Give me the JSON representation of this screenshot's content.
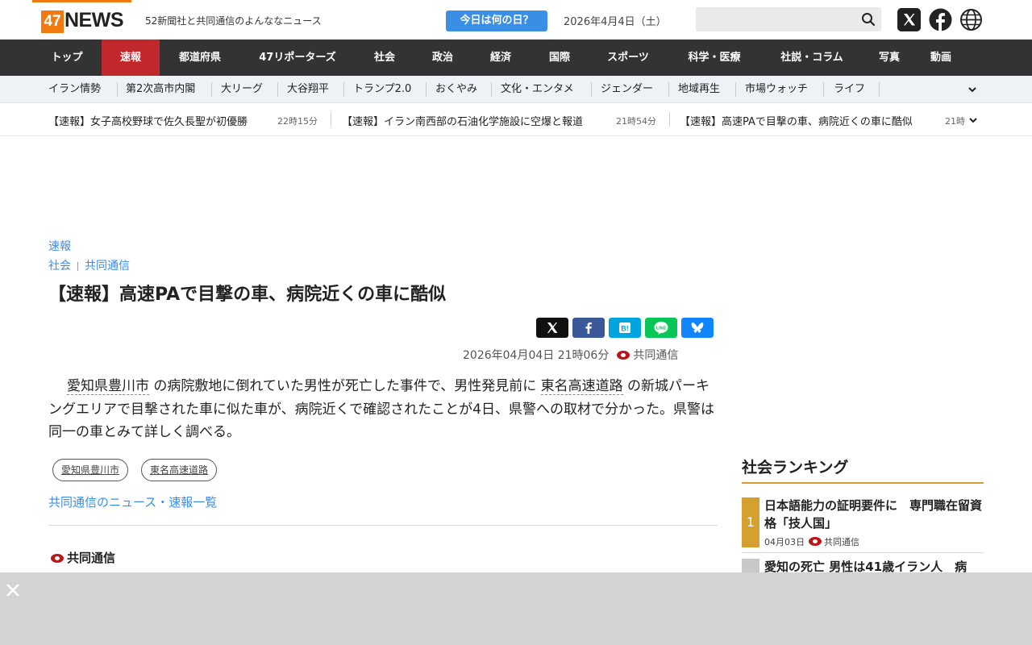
{
  "header": {
    "logo_number": "47",
    "logo_text": "NEWS",
    "tagline": "52新聞社と共同通信のよんななニュース",
    "today_button": "今日は何の日？",
    "date": "2026年4月4日（土）",
    "search_placeholder": ""
  },
  "nav": [
    {
      "label": "トップ"
    },
    {
      "label": "速報"
    },
    {
      "label": "都道府県"
    },
    {
      "label": "47リポーターズ"
    },
    {
      "label": "社会"
    },
    {
      "label": "政治"
    },
    {
      "label": "経済"
    },
    {
      "label": "国際"
    },
    {
      "label": "スポーツ"
    },
    {
      "label": "科学・医療"
    },
    {
      "label": "社説・コラム"
    },
    {
      "label": "写真"
    },
    {
      "label": "動画"
    }
  ],
  "subnav": [
    {
      "label": "イラン情勢"
    },
    {
      "label": "第2次高市内閣"
    },
    {
      "label": "大リーグ"
    },
    {
      "label": "大谷翔平"
    },
    {
      "label": "トランプ2.0"
    },
    {
      "label": "おくやみ"
    },
    {
      "label": "文化・エンタメ"
    },
    {
      "label": "ジェンダー"
    },
    {
      "label": "地域再生"
    },
    {
      "label": "市場ウォッチ"
    },
    {
      "label": "ライフ"
    }
  ],
  "ticker": [
    {
      "title": "【速報】女子高校野球で佐久長聖が初優勝",
      "time": "22時15分"
    },
    {
      "title": "【速報】イラン南西部の石油化学施設に空爆と報道",
      "time": "21時54分"
    },
    {
      "title": "【速報】高速PAで目撃の車、病院近くの車に酷似",
      "time": "21時"
    }
  ],
  "article": {
    "category": "速報",
    "breadcrumb_1": "社会",
    "breadcrumb_2": "共同通信",
    "title": "【速報】高速PAで目撃の車、病院近くの車に酷似",
    "datetime": "2026年04月04日 21時06分",
    "source": "共同通信",
    "body_kw1": "愛知県豊川市",
    "body_part1": " の病院敷地に倒れていた男性が死亡した事件で、男性発見前に ",
    "body_kw2": "東名高速道路",
    "body_part2": " の新城パーキングエリアで目撃された車に似た車が、病院近くで確認されたことが4日、県警への取材で分かった。県警は同一の車とみて詳しく調べる。",
    "tags": [
      "愛知県豊川市",
      "東名高速道路"
    ],
    "more_link": "共同通信のニュース・速報一覧",
    "footer_source": "共同通信"
  },
  "ranking": {
    "title": "社会ランキング",
    "items": [
      {
        "rank": "1",
        "text": "日本語能力の証明要件に　専門職在留資格「技人国」",
        "date": "04月03日",
        "source": "共同通信"
      },
      {
        "rank": "",
        "text": "愛知の死亡 男性は41歳イラン人　病",
        "date": "",
        "source": ""
      }
    ]
  },
  "colors": {
    "brand_orange": "#f07a10",
    "nav_dark": "#333333",
    "nav_active_red": "#c0282c",
    "link_blue": "#3a8ee6",
    "rank_gold": "#d4a030"
  }
}
